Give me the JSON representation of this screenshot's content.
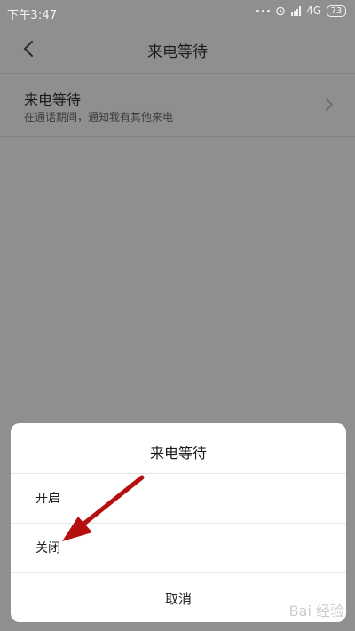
{
  "status": {
    "time": "下午3:47",
    "network": "4G",
    "battery": "73"
  },
  "header": {
    "title": "来电等待"
  },
  "setting": {
    "title": "来电等待",
    "subtitle": "在通话期间，通知我有其他来电"
  },
  "dialog": {
    "title": "来电等待",
    "options": [
      "开启",
      "关闭"
    ],
    "cancel": "取消"
  },
  "watermark": "Bai 经验"
}
